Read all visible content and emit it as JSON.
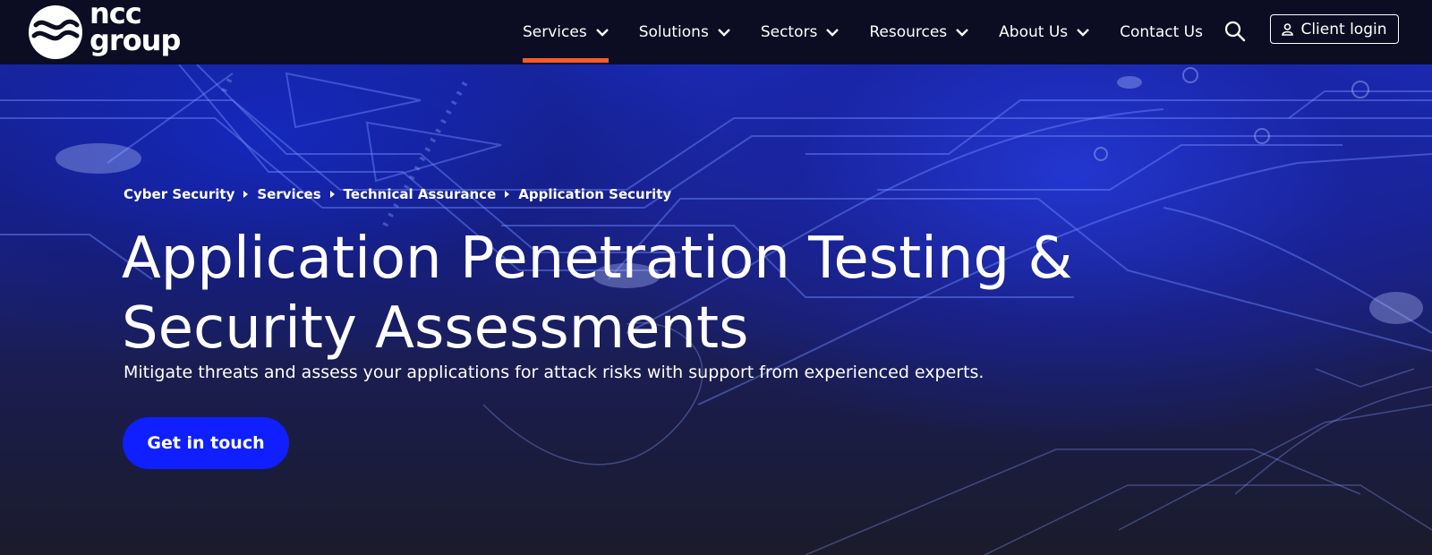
{
  "brand": {
    "line1": "ncc",
    "line2": "group"
  },
  "nav": {
    "items": [
      {
        "label": "Services"
      },
      {
        "label": "Solutions"
      },
      {
        "label": "Sectors"
      },
      {
        "label": "Resources"
      },
      {
        "label": "About Us"
      }
    ],
    "contact": "Contact Us",
    "login": "Client login"
  },
  "breadcrumb": [
    "Cyber Security",
    "Services",
    "Technical Assurance",
    "Application Security"
  ],
  "hero": {
    "title_line1": "Application Penetration Testing &",
    "title_line2": "Security Assessments",
    "subtitle": "Mitigate threats and assess your applications for attack risks with support from experienced experts.",
    "cta": "Get in touch"
  },
  "colors": {
    "accent": "#ff5a2a",
    "cta": "#0f1fff",
    "header_bg": "#0c0d22"
  }
}
